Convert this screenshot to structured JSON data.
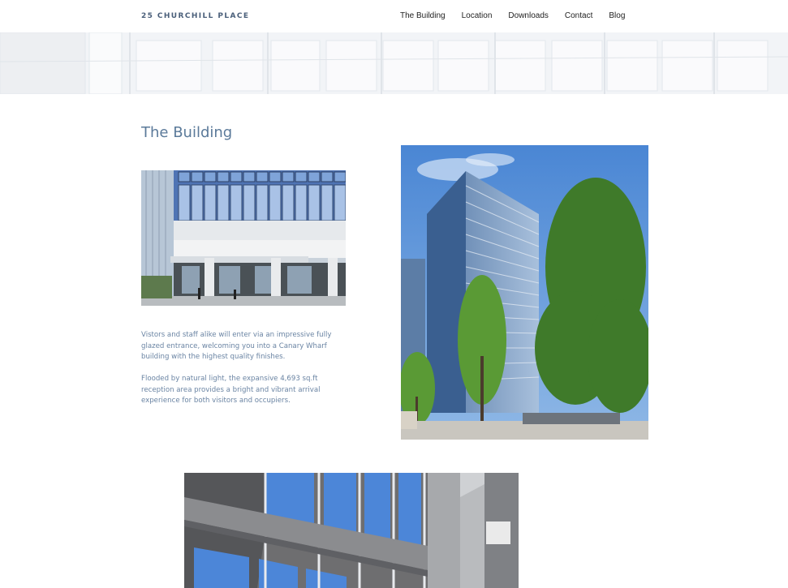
{
  "header": {
    "logo": "25 CHURCHILL PLACE",
    "nav": [
      {
        "label": "The Building"
      },
      {
        "label": "Location"
      },
      {
        "label": "Downloads"
      },
      {
        "label": "Contact"
      },
      {
        "label": "Blog"
      }
    ]
  },
  "main": {
    "title": "The Building",
    "paragraphs": [
      "Vistors and staff alike will enter via an impressive fully glazed entrance, welcoming you into a Canary Wharf building with the highest quality finishes.",
      "Flooded by natural light, the expansive 4,693 sq.ft reception area provides a bright and vibrant arrival experience for both visitors and occupiers."
    ]
  },
  "colors": {
    "heading": "#5b7a9a",
    "body_text": "#6a84a3",
    "logo": "#4a5f7a",
    "sky": "#5f93d6"
  }
}
